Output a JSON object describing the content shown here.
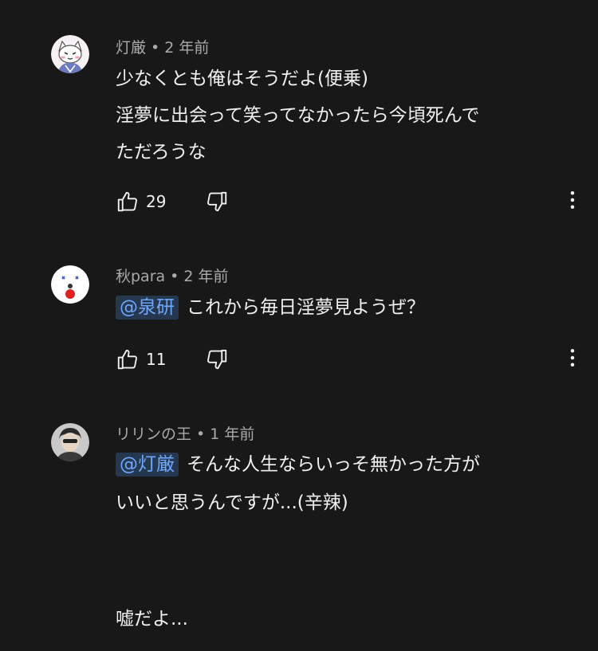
{
  "comments": [
    {
      "author": "灯厳",
      "time": "2 年前",
      "mention": "",
      "lines": [
        "少なくとも俺はそうだよ(便乗)",
        "淫夢に出会って笑ってなかったら今頃死んで",
        "ただろうな"
      ],
      "likes": "29"
    },
    {
      "author": "秋para",
      "time": "2 年前",
      "mention": "@泉研",
      "lines": [
        "これから毎日淫夢見ようぜ？"
      ],
      "likes": "11"
    },
    {
      "author": "リリンの王",
      "time": "1 年前",
      "mention": "@灯厳",
      "lines": [
        "そんな人生ならいっそ無かった方が",
        "いいと思うんですが...(辛辣)",
        "",
        "",
        "嘘だよ..."
      ],
      "likes": ""
    }
  ],
  "separator": "•",
  "icons": {
    "like": "thumbs-up-icon",
    "dislike": "thumbs-down-icon",
    "more": "more-vertical-icon"
  },
  "colors": {
    "background": "#181818",
    "text": "#f1f1f1",
    "meta": "#aaaaaa",
    "mention": "#6ea8ff",
    "mention_bg": "#263850"
  }
}
